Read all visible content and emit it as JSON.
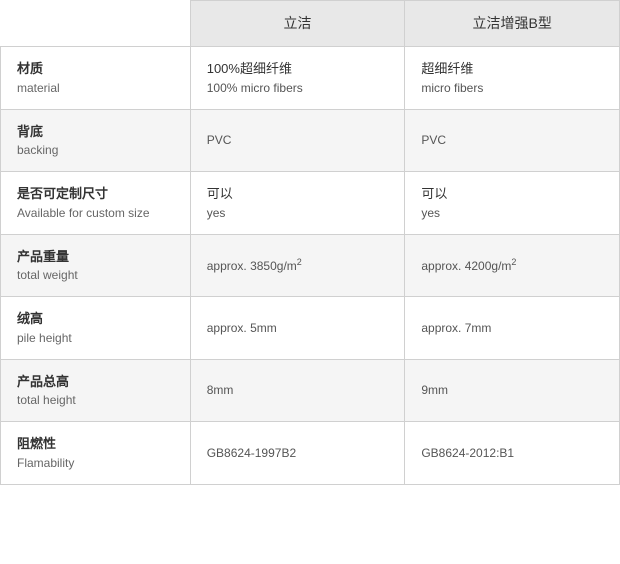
{
  "header": {
    "col_empty": "",
    "col1_label": "立洁",
    "col2_label": "立洁增强B型"
  },
  "rows": [
    {
      "id": "material",
      "label_zh": "材质",
      "label_en": "material",
      "val1_zh": "100%超细纤维",
      "val1_en": "100% micro fibers",
      "val2_zh": "超细纤维",
      "val2_en": "micro fibers"
    },
    {
      "id": "backing",
      "label_zh": "背底",
      "label_en": "backing",
      "val1_zh": "",
      "val1_en": "PVC",
      "val2_zh": "",
      "val2_en": "PVC"
    },
    {
      "id": "custom-size",
      "label_zh": "是否可定制尺寸",
      "label_en": "Available for custom size",
      "val1_zh": "可以",
      "val1_en": "yes",
      "val2_zh": "可以",
      "val2_en": "yes"
    },
    {
      "id": "total-weight",
      "label_zh": "产品重量",
      "label_en": "total weight",
      "val1_zh": "",
      "val1_en": "approx. 3850g/m²",
      "val2_zh": "",
      "val2_en": "approx. 4200g/m²"
    },
    {
      "id": "pile-height",
      "label_zh": "绒高",
      "label_en": "pile height",
      "val1_zh": "",
      "val1_en": "approx. 5mm",
      "val2_zh": "",
      "val2_en": "approx. 7mm"
    },
    {
      "id": "total-height",
      "label_zh": "产品总高",
      "label_en": "total height",
      "val1_zh": "",
      "val1_en": "8mm",
      "val2_zh": "",
      "val2_en": "9mm"
    },
    {
      "id": "flamability",
      "label_zh": "阻燃性",
      "label_en": "Flamability",
      "val1_zh": "",
      "val1_en": "GB8624-1997B2",
      "val2_zh": "",
      "val2_en": "GB8624-2012:B1"
    }
  ]
}
